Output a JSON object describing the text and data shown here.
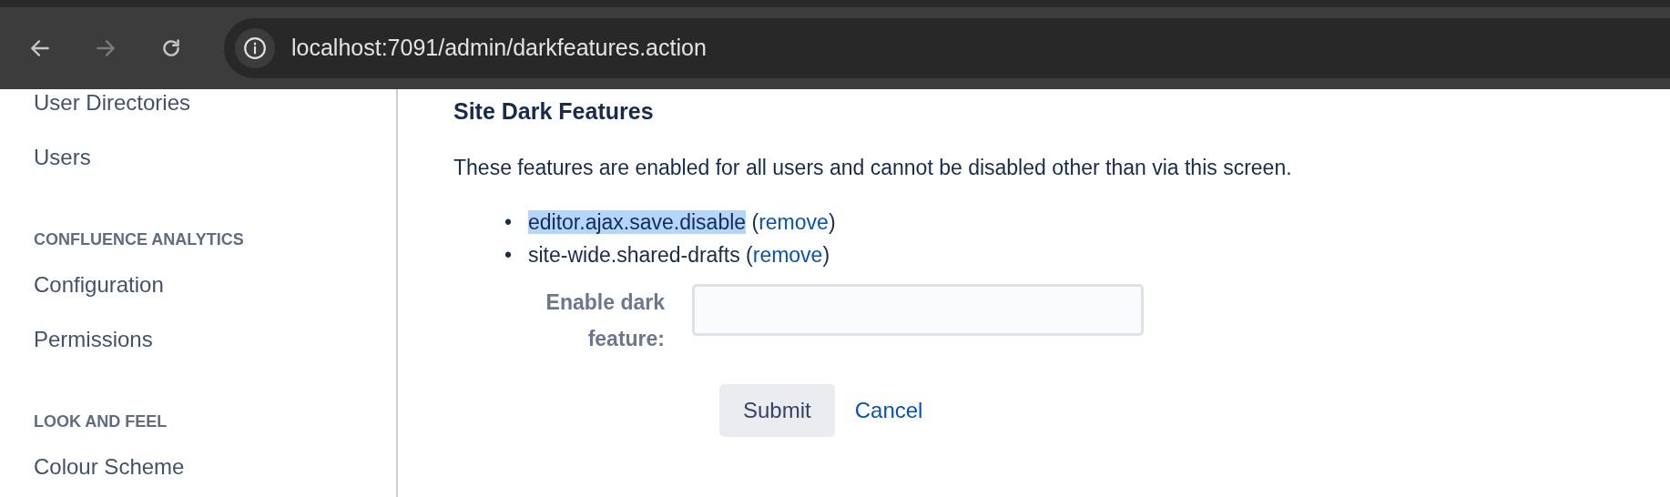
{
  "browser": {
    "url": "localhost:7091/admin/darkfeatures.action",
    "back_enabled": true,
    "forward_enabled": false
  },
  "sidebar": {
    "items": [
      {
        "kind": "link",
        "label": "User Directories"
      },
      {
        "kind": "link",
        "label": "Users"
      },
      {
        "kind": "heading",
        "label": "CONFLUENCE ANALYTICS"
      },
      {
        "kind": "link",
        "label": "Configuration"
      },
      {
        "kind": "link",
        "label": "Permissions"
      },
      {
        "kind": "heading",
        "label": "LOOK AND FEEL"
      },
      {
        "kind": "link",
        "label": "Colour Scheme"
      }
    ]
  },
  "main": {
    "title": "Site Dark Features",
    "description": "These features are enabled for all users and cannot be disabled other than via this screen.",
    "features": [
      {
        "bullet": "•",
        "name": "editor.ajax.save.disable",
        "highlighted": true,
        "open": "(",
        "action": "remove",
        "close": ")"
      },
      {
        "bullet": "•",
        "name": "site-wide.shared-drafts",
        "highlighted": false,
        "open": "(",
        "action": "remove",
        "close": ")"
      }
    ],
    "form": {
      "label": "Enable dark feature:",
      "submit": "Submit",
      "cancel": "Cancel"
    }
  }
}
